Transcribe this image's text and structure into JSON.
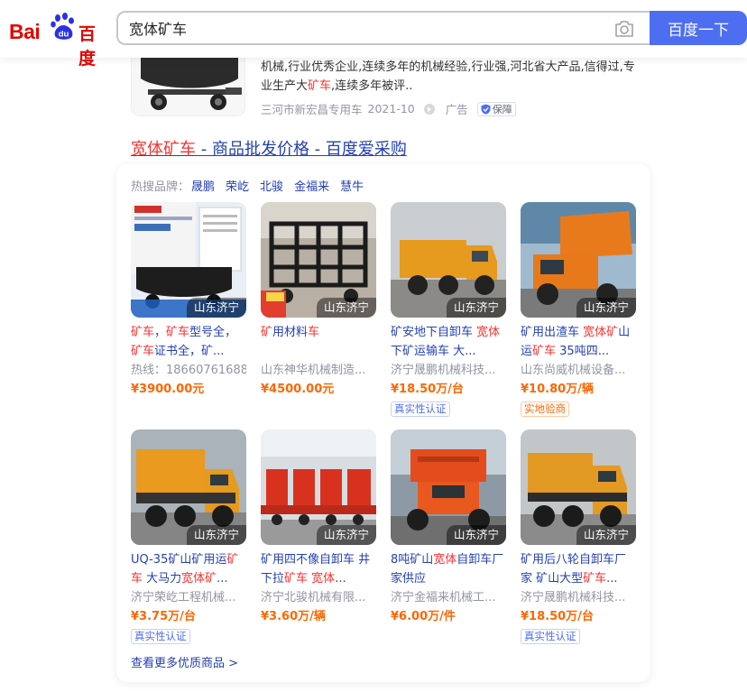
{
  "header": {
    "logo_bai": "Bai",
    "logo_du": "du",
    "logo_cn": "百度",
    "search_value": "宽体矿车",
    "search_button": "百度一下",
    "camera_icon": "camera-icon"
  },
  "ad": {
    "desc_1": "机械,行业优秀企业,连续多年的机械经验,行业强,河北省大产品,信得过,专",
    "desc_2a": "业生产大",
    "desc_2hl": "矿车",
    "desc_2b": ",连续多年被评..",
    "source": "三河市新宏昌专用车",
    "date": "2021-10",
    "ad_label": "广告",
    "guarantee": "保障"
  },
  "result": {
    "title_hl": "宽体矿车",
    "title_rest": " - 商品批发价格 - 百度爱采购"
  },
  "card": {
    "hot_label": "热搜品牌：",
    "brands": [
      "晟鹏",
      "荣屹",
      "北骏",
      "金福来",
      "慧牛"
    ],
    "more": "查看更多优质商品 >"
  },
  "products": [
    {
      "location": "山东济宁",
      "title_html": "<span class=\"hl\">矿车</span>，<span class=\"hl\">矿车</span>型号全，<span class=\"hl\">矿车</span>证书全，矿...",
      "shop": "热线：18660761688",
      "price": "¥3900.00元",
      "tag": ""
    },
    {
      "location": "山东济宁",
      "title_html": "<span class=\"hl\">矿</span>用材料<span class=\"hl\">车</span>",
      "shop": "山东神华机械制造...",
      "price": "¥4500.00元",
      "tag": ""
    },
    {
      "location": "山东济宁",
      "title_html": "矿安地下自卸车 <span class=\"hl\">宽体</span>下矿运输车 大...",
      "shop": "济宁晟鹏机械科技...",
      "price": "¥18.50万/台",
      "tag": "真实性认证",
      "tag_color": "blue"
    },
    {
      "location": "山东济宁",
      "title_html": "矿用出渣车 <span class=\"hl\">宽体矿</span>山运<span class=\"hl\">矿车</span> 35吨四...",
      "shop": "山东尚威机械设备...",
      "price": "¥10.80万/辆",
      "tag": "实地验商",
      "tag_color": "orange"
    },
    {
      "location": "山东济宁",
      "title_html": "UQ-35矿山矿用运<span class=\"hl\">矿车</span> 大马力<span class=\"hl\">宽体矿</span>...",
      "shop": "济宁荣屹工程机械...",
      "price": "¥3.75万/台",
      "tag": "真实性认证",
      "tag_color": "blue"
    },
    {
      "location": "山东济宁",
      "title_html": "矿用四不像自卸车 井下拉<span class=\"hl\">矿车</span> <span class=\"hl\">宽体</span>...",
      "shop": "济宁北骏机械有限...",
      "price": "¥3.60万/辆",
      "tag": ""
    },
    {
      "location": "山东济宁",
      "title_html": "8吨矿山<span class=\"hl\">宽体</span>自卸车厂家供应",
      "shop": "济宁金福来机械工...",
      "price": "¥6.00万/件",
      "tag": ""
    },
    {
      "location": "山东济宁",
      "title_html": "矿用后八轮自卸车厂家 矿山大型<span class=\"hl\">矿车</span>...",
      "shop": "济宁晟鹏机械科技...",
      "price": "¥18.50万/台",
      "tag": "真实性认证",
      "tag_color": "blue"
    }
  ],
  "colors": {
    "brand_red": "#e10601",
    "link_blue": "#2440b3",
    "button_blue": "#4e6ef2",
    "price_orange": "#ff6600",
    "highlight_red": "#f73131"
  }
}
